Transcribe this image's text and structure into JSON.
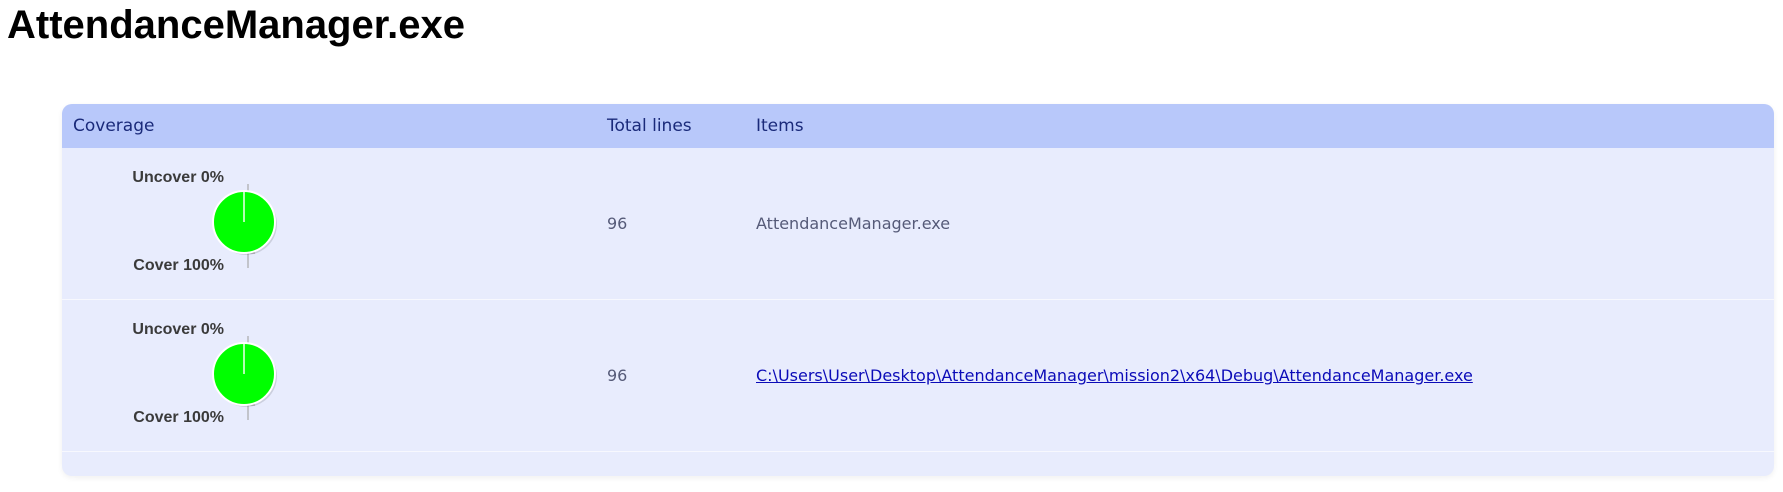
{
  "title": "AttendanceManager.exe",
  "table": {
    "headers": {
      "coverage": "Coverage",
      "total_lines": "Total lines",
      "items": "Items"
    },
    "rows": [
      {
        "uncover_label": "Uncover 0%",
        "cover_label": "Cover 100%",
        "cover_percent": 100,
        "total_lines": "96",
        "item": "AttendanceManager.exe",
        "item_is_link": false
      },
      {
        "uncover_label": "Uncover 0%",
        "cover_label": "Cover 100%",
        "cover_percent": 100,
        "total_lines": "96",
        "item": "C:\\Users\\User\\Desktop\\AttendanceManager\\mission2\\x64\\Debug\\AttendanceManager.exe",
        "item_is_link": true
      }
    ]
  },
  "colors": {
    "cover": "#00ff00",
    "header_bg": "#b8c8fa",
    "row_bg": "#e8ecfd",
    "link": "#0b0bb8"
  }
}
